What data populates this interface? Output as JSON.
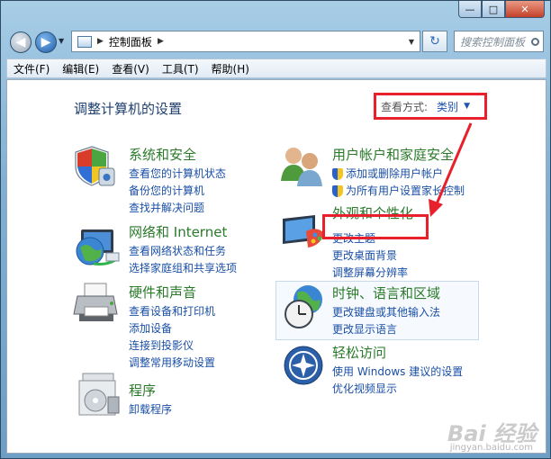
{
  "window": {
    "caption_min": "—",
    "caption_max": "□",
    "caption_close": "✕"
  },
  "nav": {
    "address_arrow": "▶",
    "address_text": "控制面板",
    "address_sep_after": "▶",
    "search_placeholder": "搜索控制面板"
  },
  "menu": [
    "文件(F)",
    "编辑(E)",
    "查看(V)",
    "工具(T)",
    "帮助(H)"
  ],
  "page_title": "调整计算机的设置",
  "viewby": {
    "label": "查看方式:",
    "value": "类别",
    "arrow": "▼"
  },
  "categories": {
    "security": {
      "title": "系统和安全",
      "links": [
        "查看您的计算机状态",
        "备份您的计算机",
        "查找并解决问题"
      ]
    },
    "network": {
      "title": "网络和 Internet",
      "links": [
        "查看网络状态和任务",
        "选择家庭组和共享选项"
      ]
    },
    "hardware": {
      "title": "硬件和声音",
      "links": [
        "查看设备和打印机",
        "添加设备",
        "连接到投影仪",
        "调整常用移动设置"
      ]
    },
    "programs": {
      "title": "程序",
      "links": [
        "卸载程序"
      ]
    },
    "users": {
      "title": "用户帐户和家庭安全",
      "links": [
        "添加或删除用户帐户",
        "为所有用户设置家长控制"
      ]
    },
    "appearance": {
      "title": "外观和个性化",
      "links": [
        "更改主题",
        "更改桌面背景",
        "调整屏幕分辨率"
      ]
    },
    "clock": {
      "title": "时钟、语言和区域",
      "links": [
        "更改键盘或其他输入法",
        "更改显示语言"
      ]
    },
    "ease": {
      "title": "轻松访问",
      "links": [
        "使用 Windows 建议的设置",
        "优化视频显示"
      ]
    }
  },
  "watermark": {
    "logo": "Bai 经验",
    "url": "jingyan.baidu.com"
  },
  "colors": {
    "accent_red": "#e8202b",
    "link_blue": "#1a4fa6",
    "category_green": "#2a7a2a"
  }
}
